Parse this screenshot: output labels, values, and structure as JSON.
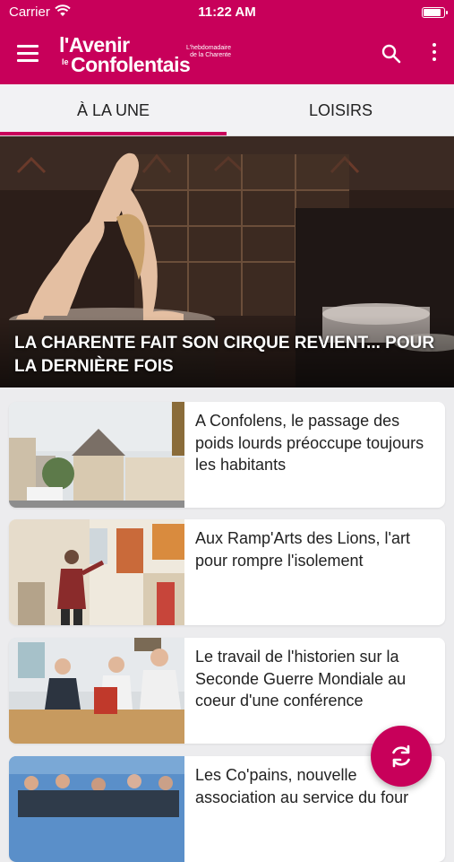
{
  "status_bar": {
    "carrier": "Carrier",
    "time": "11:22 AM"
  },
  "app_bar": {
    "logo_line1": "l'Avenir",
    "logo_le": "le",
    "logo_line2": "Confolentais",
    "logo_tagline": "L'hebdomadaire de la Charente",
    "brand_color": "#c8005a"
  },
  "tabs": [
    {
      "label": "À LA UNE",
      "selected": true
    },
    {
      "label": "LOISIRS",
      "selected": false
    }
  ],
  "hero": {
    "title": "LA CHARENTE FAIT SON CIRQUE REVIENT... POUR LA DERNIÈRE FOIS"
  },
  "articles": [
    {
      "title": "A Confolens, le passage des poids lourds préoccupe toujours les habitants"
    },
    {
      "title": "Aux Ramp'Arts des Lions, l'art pour rompre l'isolement"
    },
    {
      "title": "Le travail de l'historien sur la Seconde Guerre Mondiale au coeur d'une conférence"
    },
    {
      "title": "Les Co'pains, nouvelle association au service du four"
    }
  ],
  "icons": {
    "menu": "hamburger-menu-icon",
    "search": "search-icon",
    "more": "more-vertical-icon",
    "refresh": "refresh-icon"
  }
}
